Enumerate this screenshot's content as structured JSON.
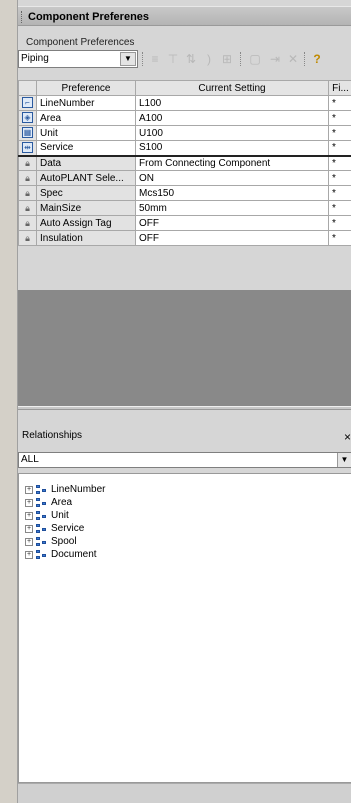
{
  "window": {
    "title": "Component Preferenes"
  },
  "panel": {
    "label": "Component Preferences"
  },
  "toolbar": {
    "category_value": "Piping",
    "help_icon": "help-icon"
  },
  "grid": {
    "columns": [
      "Preference",
      "Current Setting",
      "Fi..."
    ],
    "rows": [
      {
        "icon": "line-number-icon",
        "name": "LineNumber",
        "value": "L100",
        "flag": "*"
      },
      {
        "icon": "area-icon",
        "name": "Area",
        "value": "A100",
        "flag": "*"
      },
      {
        "icon": "unit-icon",
        "name": "Unit",
        "value": "U100",
        "flag": "*"
      },
      {
        "icon": "service-icon",
        "name": "Service",
        "value": "S100",
        "flag": "*"
      },
      {
        "icon": "lock-icon",
        "name": "Data",
        "value": "From Connecting Component",
        "flag": "*"
      },
      {
        "icon": "lock-icon",
        "name": "AutoPLANT Sele...",
        "value": "ON",
        "flag": "*"
      },
      {
        "icon": "lock-icon",
        "name": "Spec",
        "value": "Mcs150",
        "flag": "*"
      },
      {
        "icon": "lock-icon",
        "name": "MainSize",
        "value": "50mm",
        "flag": "*"
      },
      {
        "icon": "lock-icon",
        "name": "Auto Assign Tag",
        "value": "OFF",
        "flag": "*"
      },
      {
        "icon": "lock-icon",
        "name": "Insulation",
        "value": "OFF",
        "flag": "*"
      }
    ]
  },
  "relationships": {
    "title": "Relationships",
    "close": "×",
    "filter_value": "ALL",
    "items": [
      "LineNumber",
      "Area",
      "Unit",
      "Service",
      "Spool",
      "Document"
    ]
  }
}
